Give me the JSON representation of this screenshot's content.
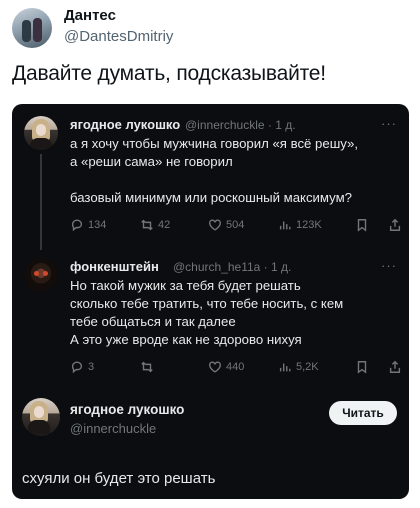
{
  "outer": {
    "name": "Дантес",
    "handle": "@DantesDmitriy",
    "text": "Давайте думать, подсказывайте!"
  },
  "tweets": [
    {
      "name": "ягодное лукошко",
      "meta": "@innerchuckle · 1 д.",
      "lines": [
        "а я хочу чтобы мужчина говорил «я всё решу»,",
        "а «реши сама» не говорил",
        "",
        "базовый минимум или роскошный максимум?"
      ],
      "stats": {
        "reply": "134",
        "retweet": "42",
        "like": "504",
        "views": "123K"
      }
    },
    {
      "name": "фонкенштейн",
      "meta": "@church_he11a · 1 д.",
      "lines": [
        "Но такой мужик за тебя будет решать",
        "сколько тебе тратить, что тебе носить, с кем",
        "тебе общаться и так далее",
        "А это уже вроде как не здорово нихуя"
      ],
      "stats": {
        "reply": "3",
        "retweet": "",
        "like": "440",
        "views": "5,2K"
      }
    }
  ],
  "bottom": {
    "name": "ягодное лукошко",
    "handle": "@innerchuckle",
    "read_label": "Читать",
    "text": "схуяли он будет это решать"
  },
  "more_glyph": "···"
}
